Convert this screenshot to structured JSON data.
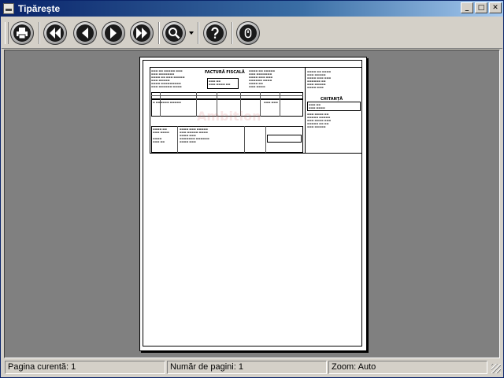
{
  "window": {
    "title": "Tipărește"
  },
  "titlebar_buttons": {
    "minimize": "_",
    "maximize": "□",
    "close": "✕"
  },
  "toolbar": {
    "buttons": [
      {
        "name": "print-button",
        "icon": "printer-icon"
      },
      {
        "name": "first-page-button",
        "icon": "double-left-arrow-icon"
      },
      {
        "name": "previous-page-button",
        "icon": "left-arrow-icon"
      },
      {
        "name": "next-page-button",
        "icon": "right-arrow-icon"
      },
      {
        "name": "last-page-button",
        "icon": "double-right-arrow-icon"
      },
      {
        "name": "zoom-button",
        "icon": "magnifier-icon"
      },
      {
        "name": "help-button",
        "icon": "question-mark-icon"
      },
      {
        "name": "exit-button",
        "icon": "power-icon"
      }
    ]
  },
  "document": {
    "invoice_title": "FACTURĂ FISCALĂ",
    "receipt_title": "CHITANȚĂ",
    "watermark": "Ambition"
  },
  "statusbar": {
    "current_page": "Pagina curentă: 1",
    "page_count": "Număr de pagini: 1",
    "zoom": "Zoom: Auto"
  }
}
